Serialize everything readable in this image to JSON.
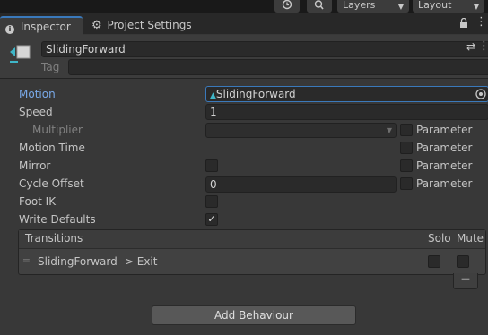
{
  "toolbar": {
    "history_icon": "history-icon",
    "search_icon": "search-icon",
    "layers_label": "Layers",
    "layout_label": "Layout"
  },
  "tabs": [
    {
      "label": "Inspector",
      "icon": "info-icon"
    },
    {
      "label": "Project Settings",
      "icon": "gear-icon"
    }
  ],
  "header": {
    "name": "SlidingForward",
    "tag_label": "Tag"
  },
  "properties": {
    "motion_label": "Motion",
    "motion_value": "SlidingForward",
    "speed_label": "Speed",
    "speed_value": "1",
    "multiplier_label": "Multiplier",
    "motion_time_label": "Motion Time",
    "mirror_label": "Mirror",
    "cycle_offset_label": "Cycle Offset",
    "cycle_offset_value": "0",
    "foot_ik_label": "Foot IK",
    "write_defaults_label": "Write Defaults",
    "parameter_label": "Parameter"
  },
  "transitions": {
    "header": "Transitions",
    "solo_label": "Solo",
    "mute_label": "Mute",
    "items": [
      {
        "label": "SlidingForward -> Exit"
      }
    ],
    "remove_label": "−"
  },
  "add_behaviour_label": "Add Behaviour",
  "colors": {
    "background": "#383838",
    "accent_blue": "#3a79bb",
    "motion_label": "#79a9e8"
  }
}
